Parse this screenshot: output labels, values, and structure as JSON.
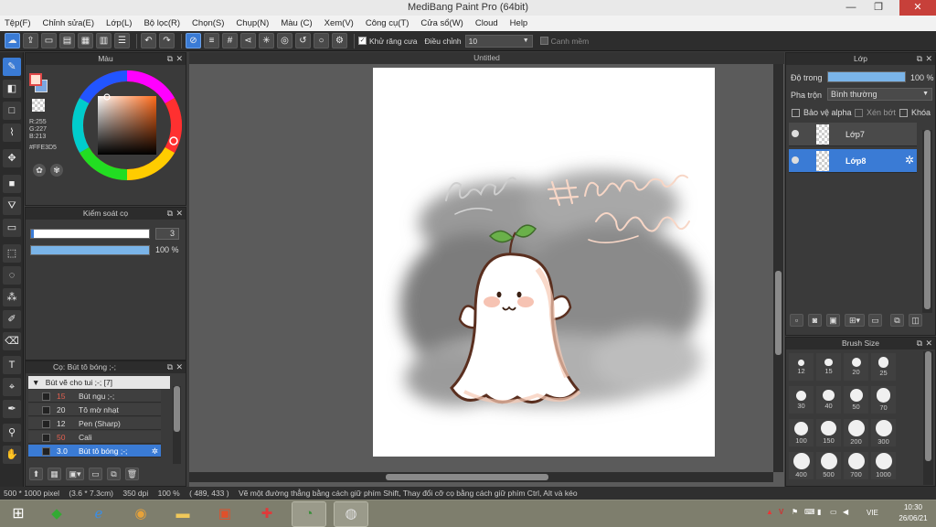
{
  "window": {
    "title": "MediBang Paint Pro (64bit)",
    "minimize": "—",
    "maximize": "❐",
    "close": "✕"
  },
  "menu": [
    "Tệp(F)",
    "Chỉnh sửa(E)",
    "Lớp(L)",
    "Bộ lọc(R)",
    "Chọn(S)",
    "Chụp(N)",
    "Màu (C)",
    "Xem(V)",
    "Công cụ(T)",
    "Cửa sổ(W)",
    "Cloud",
    "Help"
  ],
  "toolbar": {
    "antialias_label": "Khử răng cưa",
    "antialias_checked": true,
    "adjust_label": "Điều chỉnh",
    "adjust_value": "10",
    "smooth_label": "Canh mềm",
    "smooth_checked": false
  },
  "color_panel": {
    "title": "Màu",
    "r": "R:255",
    "g": "G:227",
    "b": "B:213",
    "hex": "#FFE3D5",
    "foreground_color": "#ffe3d5",
    "background_color": "#7aa6e0"
  },
  "brush_control": {
    "title": "Kiểm soát cọ",
    "size_value": "3",
    "opacity_value": "100 %",
    "size_fraction": 0.02,
    "opacity_fraction": 1.0
  },
  "brush_panel": {
    "title": "Cọ: Bút tô bóng ;-;",
    "group_label": "Bút vẽ cho tui ;-; [7]",
    "items": [
      {
        "size": "15",
        "name": "Bút ngu ;-;",
        "size_color": "#e06050"
      },
      {
        "size": "20",
        "name": "Tô mờ nhạt",
        "size_color": "#dddddd"
      },
      {
        "size": "12",
        "name": "Pen (Sharp)",
        "size_color": "#dddddd"
      },
      {
        "size": "50",
        "name": "Cali",
        "size_color": "#e06050"
      },
      {
        "size": "3.0",
        "name": "Bút tô bóng ;-;",
        "size_color": "#ffffff",
        "selected": true
      }
    ]
  },
  "canvas": {
    "tab_title": "Untitled"
  },
  "layer_panel": {
    "title": "Lớp",
    "opacity_label": "Độ trong",
    "opacity_value": "100 %",
    "opacity_fraction": 1.0,
    "blend_label": "Pha trộn",
    "blend_value": "Bình thường",
    "protect_alpha": "Bảo vệ alpha",
    "clipping": "Xén bớt",
    "lock": "Khóa",
    "layers": [
      {
        "name": "Lớp7",
        "selected": false
      },
      {
        "name": "Lớp8",
        "selected": true
      }
    ]
  },
  "brush_size_panel": {
    "title": "Brush Size",
    "sizes": [
      "12",
      "15",
      "20",
      "25",
      "30",
      "40",
      "50",
      "70",
      "100",
      "150",
      "200",
      "300",
      "400",
      "500",
      "700",
      "1000"
    ]
  },
  "status": {
    "dimensions": "500 * 1000 pixel",
    "physical": "(3.6 * 7.3cm)",
    "dpi": "350 dpi",
    "zoom": "100 %",
    "coords": "( 489, 433 )",
    "hint": "Vẽ một đường thẳng bằng cách giữ phím Shift, Thay đổi cỡ cọ bằng cách giữ phím Ctrl, Alt và kéo"
  },
  "taskbar": {
    "lang": "VIE",
    "time": "10:30",
    "date": "26/06/21"
  }
}
